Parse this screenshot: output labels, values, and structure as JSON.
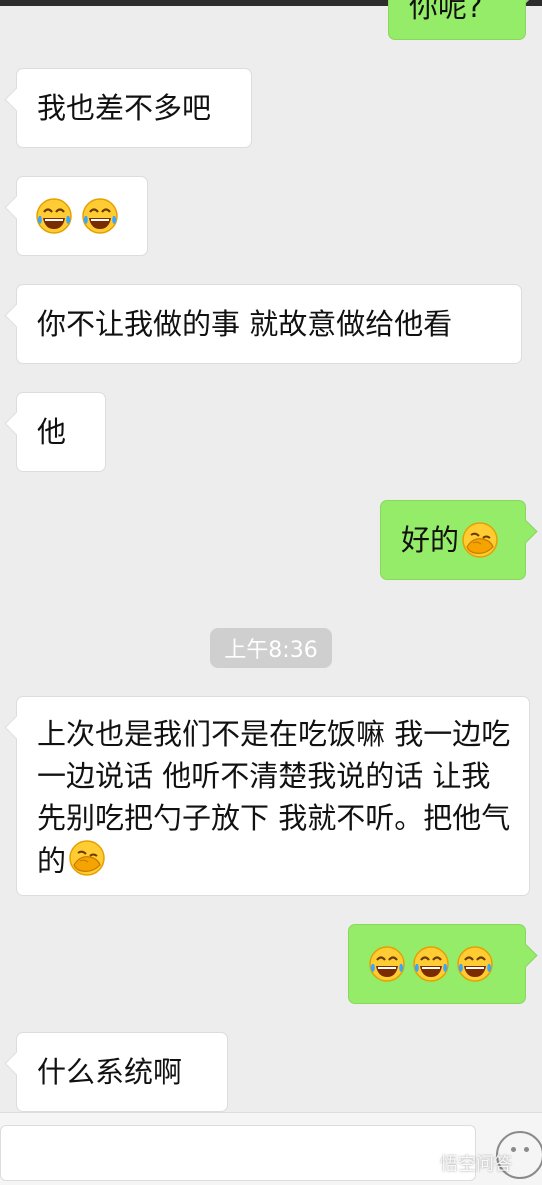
{
  "messages": [
    {
      "text": "你呢?"
    },
    {
      "text": "我也差不多吧"
    },
    {
      "emoji": "tears-of-joy"
    },
    {
      "text": "你不让我做的事 就故意做给他看"
    },
    {
      "text": "他"
    },
    {
      "text": "好的"
    },
    {
      "time": "上午8:36"
    },
    {
      "text": "上次也是我们不是在吃饭嘛  我一边吃一边说话 他听不清楚我说的话 让我先别吃把勺子放下 我就不听。把他气的"
    },
    {
      "emoji": "tears-of-joy"
    },
    {
      "text": "什么系统啊"
    }
  ],
  "watermark": "悟空问答",
  "colors": {
    "incoming": "#ffffff",
    "outgoing": "#95ec69",
    "background": "#ededed"
  }
}
